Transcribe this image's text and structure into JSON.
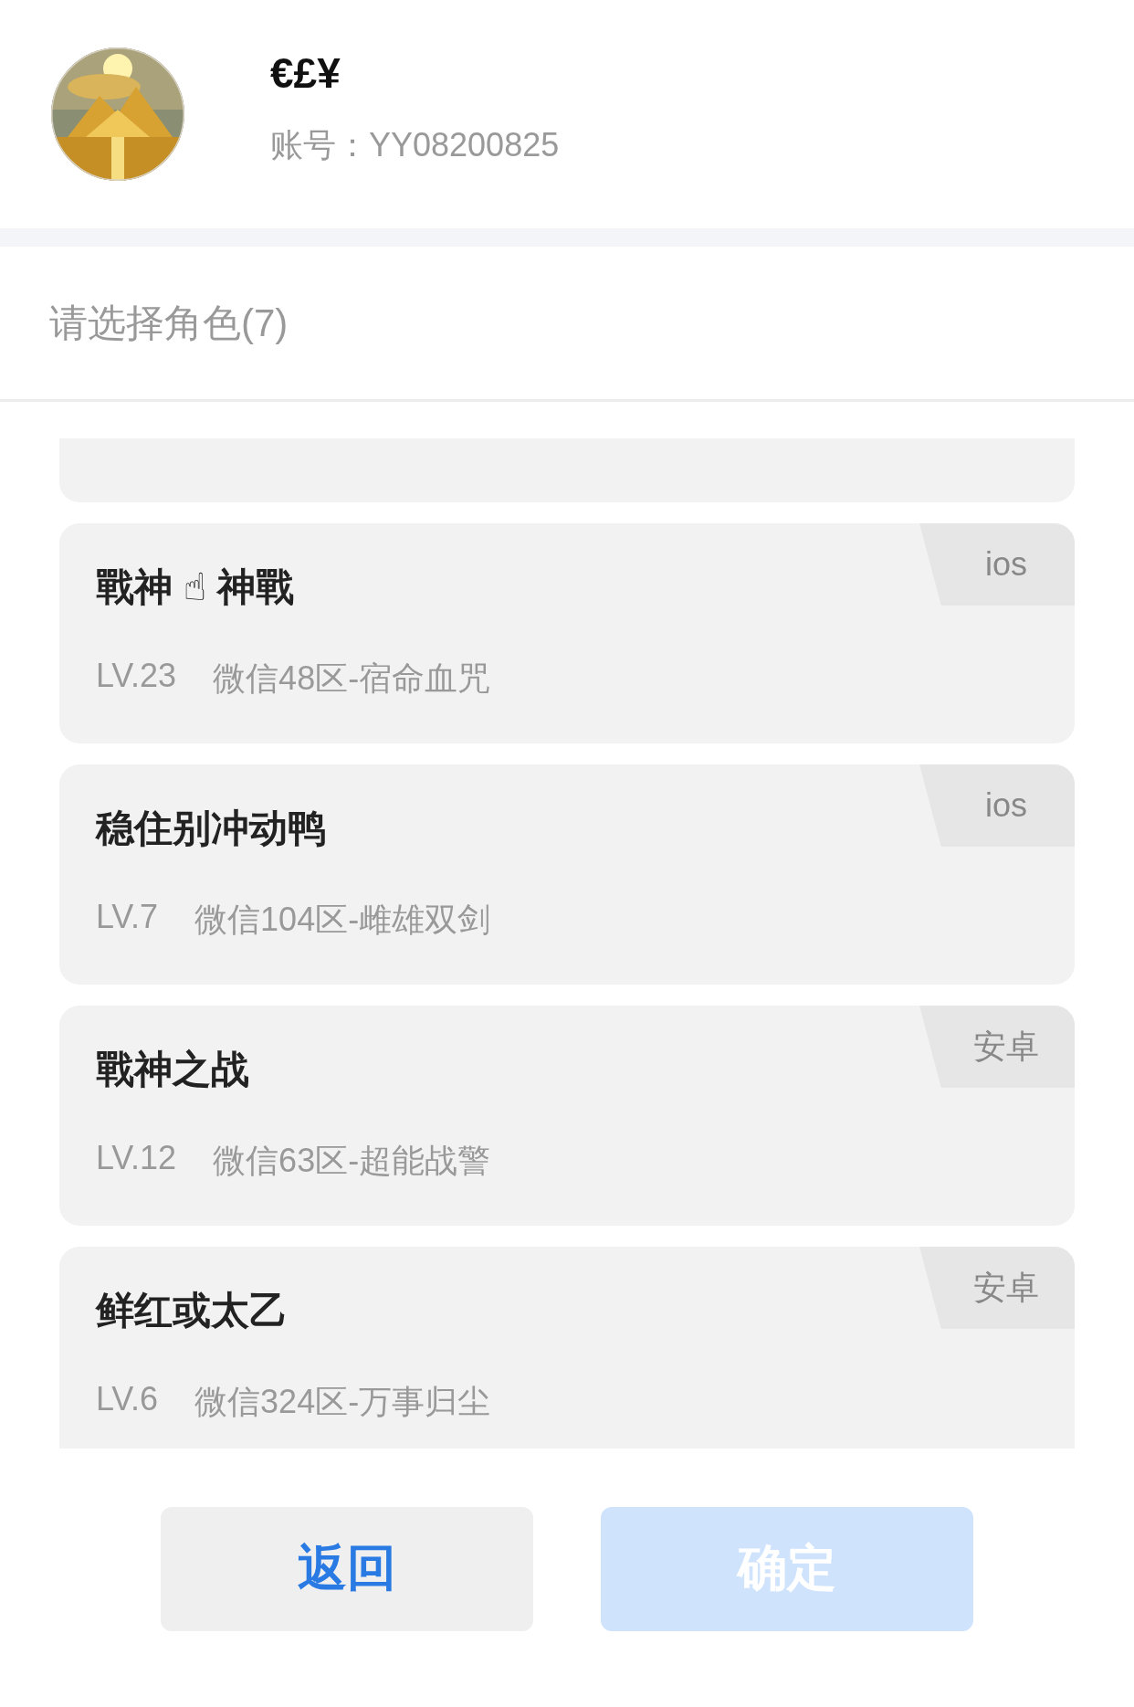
{
  "profile": {
    "name": "€£¥",
    "account_label": "账号：",
    "account": "YY08200825"
  },
  "section_title": "请选择角色(7)",
  "roles": [
    {
      "kind": "cut"
    },
    {
      "kind": "full",
      "name": "戰神 ☝ 神戰",
      "level": "LV.23",
      "server": "微信48区-宿命血咒",
      "platform": "ios"
    },
    {
      "kind": "full",
      "name": "稳住别冲动鸭",
      "level": "LV.7",
      "server": "微信104区-雌雄双剑",
      "platform": "ios"
    },
    {
      "kind": "full",
      "name": "戰神之战",
      "level": "LV.12",
      "server": "微信63区-超能战警",
      "platform": "安卓"
    },
    {
      "kind": "full",
      "name": "鲜红或太乙",
      "level": "LV.6",
      "server": "微信324区-万事归尘",
      "platform": "安卓"
    }
  ],
  "buttons": [
    {
      "label": "返回",
      "kind": "back",
      "disabled": false
    },
    {
      "label": "确定",
      "kind": "confirm",
      "disabled": true
    }
  ]
}
